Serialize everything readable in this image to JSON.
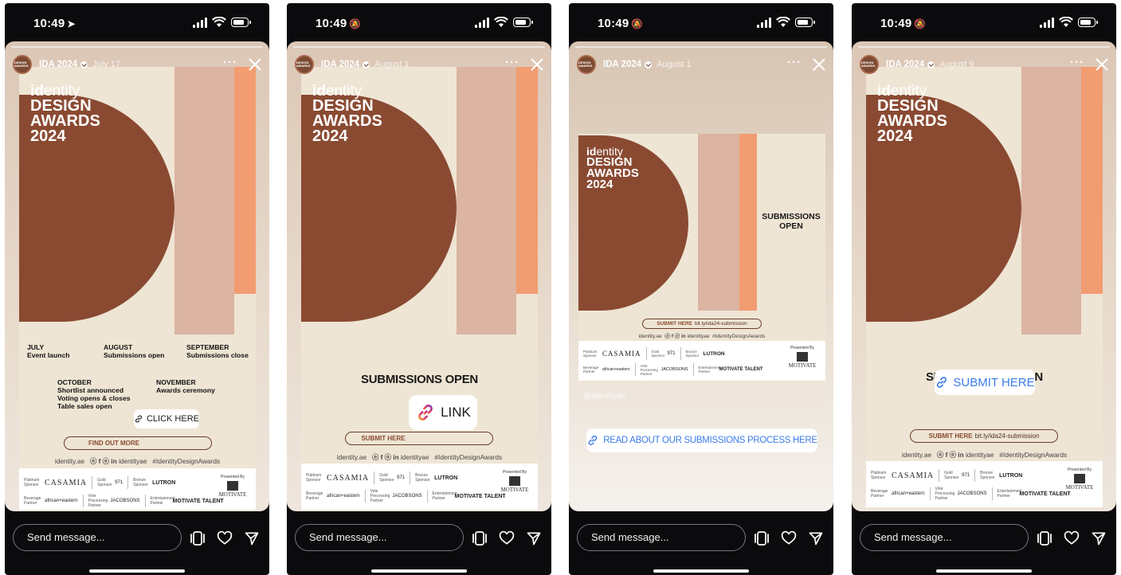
{
  "colors": {
    "brown": "#8a4a32",
    "salmon": "#f29c72",
    "blush": "#dbb4a2",
    "cream": "#efe5d4",
    "link_blue": "#3b7bea"
  },
  "common": {
    "account": "IDA 2024",
    "avatar_text": "DESIGN AWARDS",
    "more": "···",
    "message_placeholder": "Send message...",
    "logo_bold": "id",
    "logo_light": "entity",
    "logo_line2": "DESIGN",
    "logo_line3": "AWARDS",
    "logo_line4": "2024",
    "submit_here": "SUBMIT HERE",
    "submit_url": "bit.ly/ida24-submission",
    "social_site": "identity.ae",
    "social_icons": "ⓞ f ⓞ in",
    "social_handle": "identityae",
    "social_tag": "#IdentityDesignAwards",
    "submissions_open": "SUBMISSIONS OPEN",
    "submissions_open_2": "SUBMISSIONS",
    "submissions_open_3": "OPEN",
    "sponsors": {
      "platinum_label": "Platinum Sponsor",
      "platinum": "CASAMIA",
      "gold_label": "Gold Sponsor",
      "gold": "971",
      "bronze_label": "Bronze Sponsor",
      "bronze": "LUTRON",
      "beverage_label": "Beverage Partner",
      "beverage": "african+eastern",
      "voice_label": "Vote Processing Partner",
      "voice": "JACOBSONS",
      "ent_label": "Entertainment Partner",
      "ent": "MOTIVATE TALENT",
      "presented": "Presented By",
      "presenter": "MOTIVATE"
    }
  },
  "screens": [
    {
      "time": "10:49",
      "date": "July 17",
      "timeline": {
        "july_month": "JULY",
        "july_text": "Event launch",
        "aug_month": "AUGUST",
        "aug_text": "Submissions open",
        "sep_month": "SEPTEMBER",
        "sep_text": "Submissions close",
        "oct_month": "OCTOBER",
        "oct_l1": "Shortlist announced",
        "oct_l2": "Voting opens & closes",
        "oct_l3": "Table sales open",
        "nov_month": "NOVEMBER",
        "nov_text": "Awards ceremony"
      },
      "find_out_more": "FIND OUT MORE",
      "sticker": "CLICK HERE"
    },
    {
      "time": "10:49",
      "date": "August 1",
      "sticker": "LINK"
    },
    {
      "time": "10:49",
      "date": "August 1",
      "mention": "@identityae",
      "sticker": "READ ABOUT OUR SUBMISSIONS PROCESS HERE"
    },
    {
      "time": "10:49",
      "date": "August 9",
      "sticker": "SUBMIT HERE"
    }
  ]
}
